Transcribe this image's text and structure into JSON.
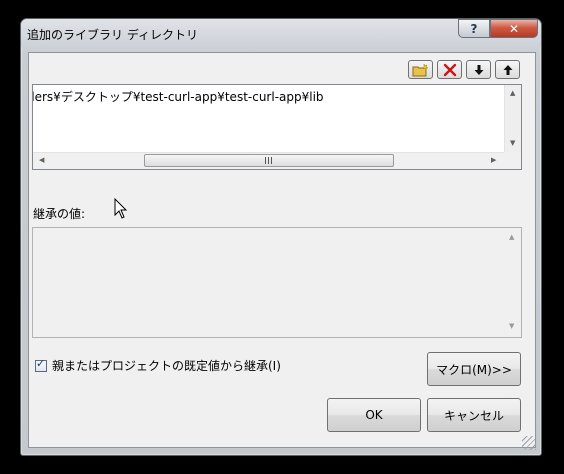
{
  "window": {
    "title": "追加のライブラリ ディレクトリ",
    "help_label": "?",
    "close_label": "✕"
  },
  "toolbar": {
    "icons": [
      "new-folder-icon",
      "delete-icon",
      "move-down-icon",
      "move-up-icon"
    ]
  },
  "directory_list": {
    "entries": [
      "ders¥デスクトップ¥test-curl-app¥test-curl-app¥lib"
    ]
  },
  "inherit": {
    "label": "継承の値:",
    "values": []
  },
  "checkbox": {
    "label": "親またはプロジェクトの既定値から継承(I)",
    "checked": true
  },
  "buttons": {
    "macro": "マクロ(M)>>",
    "ok": "OK",
    "cancel": "キャンセル"
  },
  "colors": {
    "close_button": "#cf5b45",
    "dialog_background": "#f0f0f0"
  }
}
